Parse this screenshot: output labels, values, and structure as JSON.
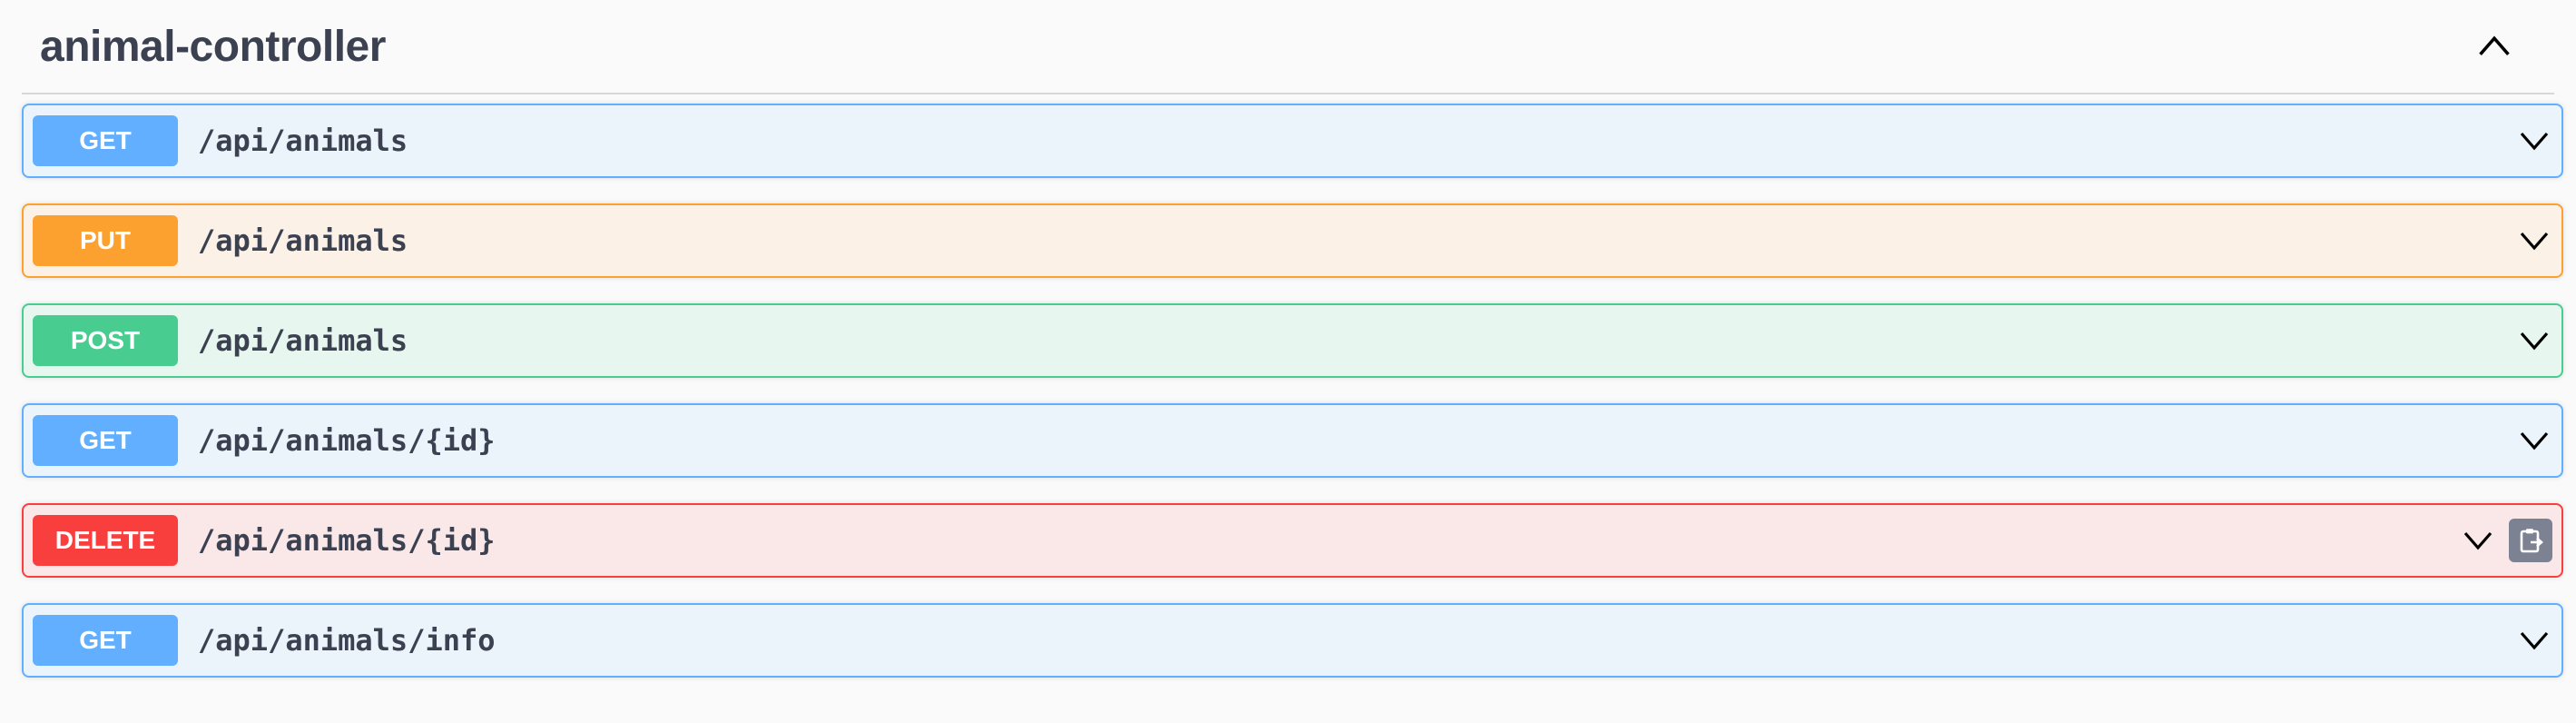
{
  "section": {
    "title": "animal-controller"
  },
  "operations": [
    {
      "method": "GET",
      "path": "/api/animals"
    },
    {
      "method": "PUT",
      "path": "/api/animals"
    },
    {
      "method": "POST",
      "path": "/api/animals"
    },
    {
      "method": "GET",
      "path": "/api/animals/{id}"
    },
    {
      "method": "DELETE",
      "path": "/api/animals/{id}",
      "copy_icon": "clipboard-icon"
    },
    {
      "method": "GET",
      "path": "/api/animals/info"
    }
  ],
  "icons": {
    "collapse": "chevron-up-icon",
    "expand": "chevron-down-icon",
    "copy": "clipboard-icon"
  },
  "colors": {
    "get": "#61affe",
    "put": "#fca130",
    "post": "#49cc90",
    "delete": "#f93e3e",
    "text": "#3b4151",
    "copy_button": "#7d8293"
  }
}
